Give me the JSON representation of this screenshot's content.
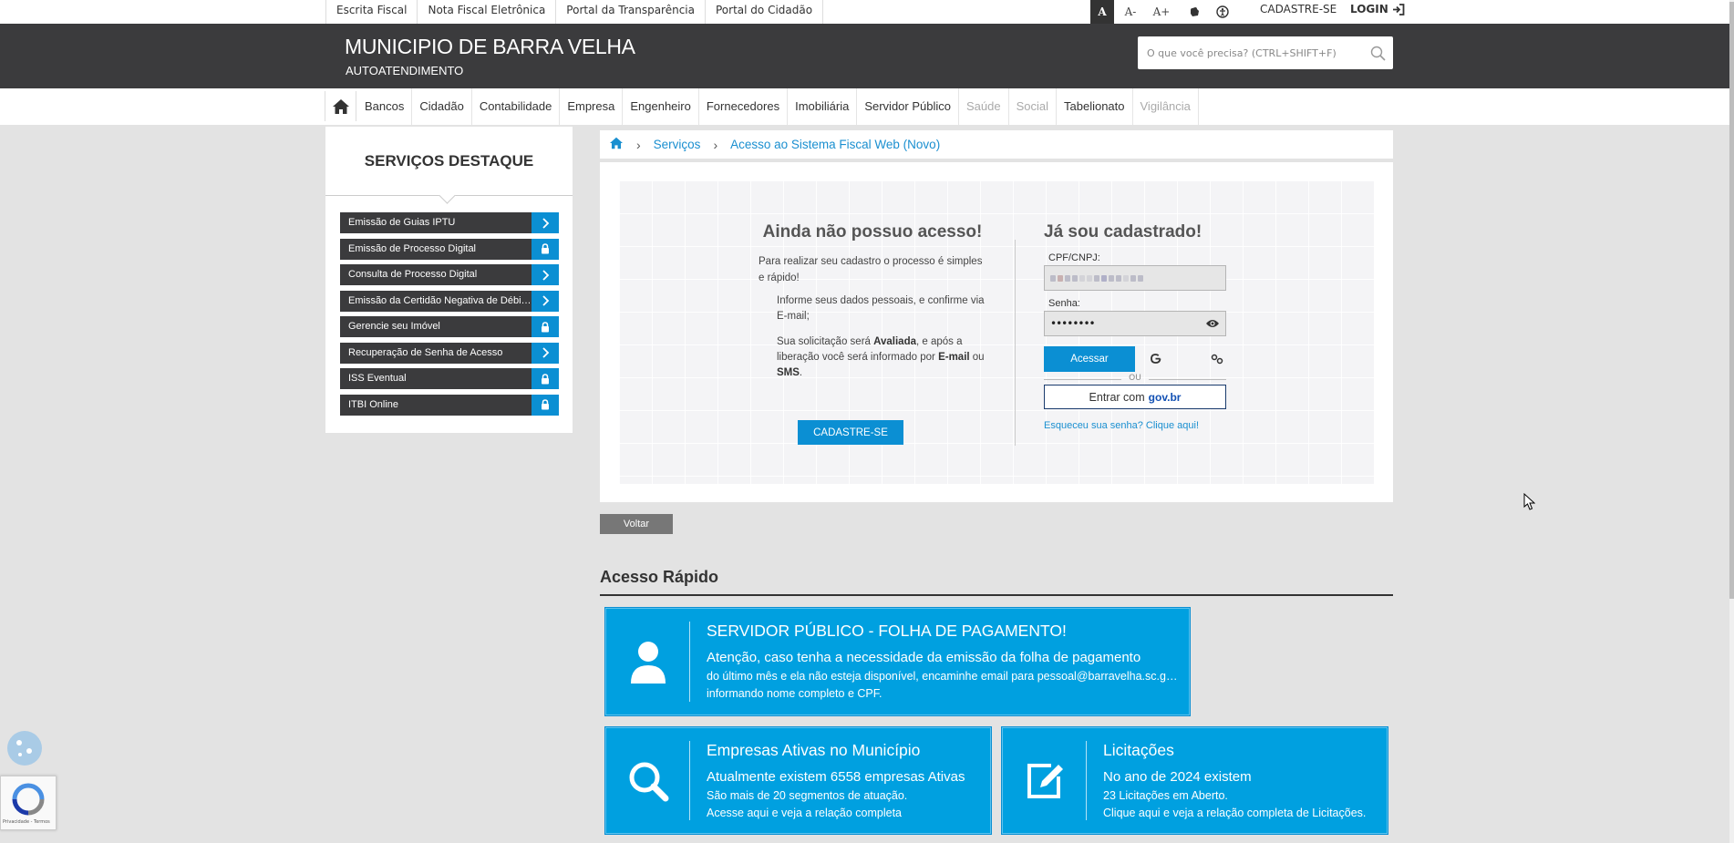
{
  "topbar": {
    "links": [
      "Escrita Fiscal",
      "Nota Fiscal Eletrônica",
      "Portal da Transparência",
      "Portal do Cidadão"
    ],
    "acc_a": "A",
    "acc_minus": "A-",
    "acc_plus": "A+",
    "cadastre": "CADASTRE-SE",
    "login": "LOGIN"
  },
  "header": {
    "title": "MUNICIPIO DE BARRA VELHA",
    "subtitle": "AUTOATENDIMENTO",
    "search_placeholder": "O que você precisa? (CTRL+SHIFT+F)"
  },
  "nav": {
    "items": [
      {
        "label": "Bancos"
      },
      {
        "label": "Cidadão"
      },
      {
        "label": "Contabilidade"
      },
      {
        "label": "Empresa"
      },
      {
        "label": "Engenheiro"
      },
      {
        "label": "Fornecedores"
      },
      {
        "label": "Imobiliária"
      },
      {
        "label": "Servidor Público"
      },
      {
        "label": "Saúde"
      },
      {
        "label": "Social"
      },
      {
        "label": "Tabelionato"
      },
      {
        "label": "Vigilância"
      }
    ]
  },
  "sidebar": {
    "title": "SERVIÇOS DESTAQUE",
    "items": [
      {
        "label": "Emissão de Guias IPTU",
        "icon": "chevron-right-icon"
      },
      {
        "label": "Emissão de Processo Digital",
        "icon": "lock-icon"
      },
      {
        "label": "Consulta de Processo Digital",
        "icon": "chevron-right-icon"
      },
      {
        "label": "Emissão da Certidão Negativa de Débitos",
        "icon": "chevron-right-icon"
      },
      {
        "label": "Gerencie seu Imóvel",
        "icon": "lock-icon"
      },
      {
        "label": "Recuperação de Senha de Acesso",
        "icon": "chevron-right-icon"
      },
      {
        "label": "ISS Eventual",
        "icon": "lock-icon"
      },
      {
        "label": "ITBI Online",
        "icon": "lock-icon"
      }
    ]
  },
  "breadcrumb": {
    "servicos": "Serviços",
    "current": "Acesso ao Sistema Fiscal Web (Novo)"
  },
  "register": {
    "title": "Ainda não possuo acesso!",
    "intro": "Para realizar seu cadastro o processo é simples e rápido!",
    "step1": "Informe seus dados pessoais, e confirme via E-mail;",
    "step2_a": "Sua solicitação será ",
    "step2_b": "Avaliada",
    "step2_c": ", e após a liberação você será informado por ",
    "step2_d": "E-mail",
    "step2_e": " ou ",
    "step2_f": "SMS",
    "step2_g": ".",
    "button": "CADASTRE-SE"
  },
  "login": {
    "title": "Já sou cadastrado!",
    "cpf_label": "CPF/CNPJ:",
    "senha_label": "Senha:",
    "senha_value": "••••••••",
    "acessar": "Acessar",
    "ou": "OU",
    "gov_prefix": "Entrar com",
    "gov_logo": "gov.br",
    "forgot": "Esqueceu sua senha? Clique aqui!"
  },
  "voltar": "Voltar",
  "acesso_rapido": {
    "title": "Acesso Rápido",
    "cards": [
      {
        "title": "SERVIDOR PÚBLICO - FOLHA DE PAGAMENTO!",
        "line1": "Atenção, caso tenha a necessidade da emissão da folha de pagamento",
        "line2": "do último mês e ela não esteja disponível, encaminhe email para pessoal@barravelha.sc.gov.br",
        "line3": "informando nome completo e CPF.",
        "icon": "user-icon"
      },
      {
        "title": "Empresas Ativas no Município",
        "line1": "Atualmente existem 6558 empresas Ativas",
        "line2": "São mais de 20 segmentos de atuação.",
        "line3": "Acesse aqui e veja a relação completa",
        "icon": "search-icon"
      },
      {
        "title": "Licitações",
        "line1": "No ano de 2024 existem",
        "line2": "23 Licitações em Aberto.",
        "line3": "Clique aqui e veja a relação completa de Licitações.",
        "icon": "edit-icon"
      }
    ]
  },
  "recaptcha": {
    "text": "Privacidade - Termos"
  },
  "colors": {
    "accent": "#0b8fd3",
    "header": "#3b3b3d",
    "card": "#00a0e0"
  }
}
